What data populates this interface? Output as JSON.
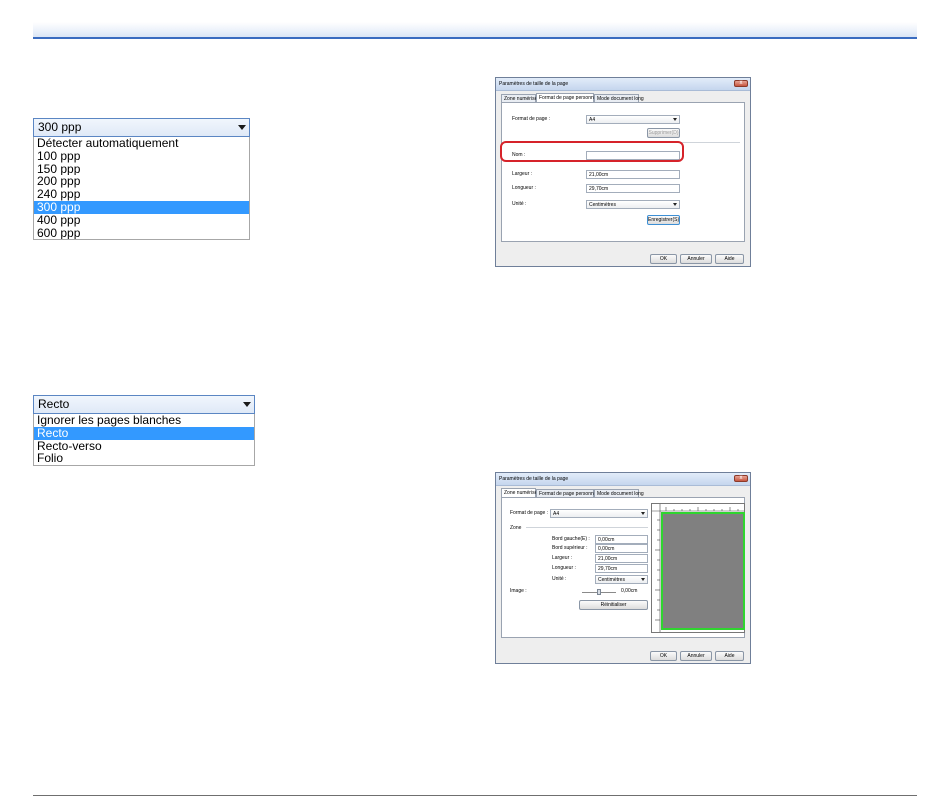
{
  "resolution_dropdown": {
    "selected": "300 ppp",
    "options": [
      "Détecter automatiquement",
      "100 ppp",
      "150 ppp",
      "200 ppp",
      "240 ppp",
      "300 ppp",
      "400 ppp",
      "600 ppp"
    ],
    "highlighted_index": 5
  },
  "side_dropdown": {
    "selected": "Recto",
    "options": [
      "Ignorer les pages blanches",
      "Recto",
      "Recto-verso",
      "Folio"
    ],
    "highlighted_index": 1
  },
  "dialog1": {
    "title": "Paramètres de taille de la page",
    "close": "x",
    "tabs": [
      "Zone numérisée",
      "Format de page personnalisé",
      "Mode document long"
    ],
    "active_tab": 1,
    "format_label": "Format de page :",
    "format_value": "A4",
    "delete_button": "Supprimer(D)",
    "name_label": "Nom :",
    "name_value": "",
    "width_label": "Largeur :",
    "width_value": "21,00cm",
    "length_label": "Longueur :",
    "length_value": "29,70cm",
    "unit_label": "Unité :",
    "unit_value": "Centimètres",
    "save_button": "Enregistrer(S)",
    "ok": "OK",
    "cancel": "Annuler",
    "help": "Aide"
  },
  "dialog2": {
    "title": "Paramètres de taille de la page",
    "close": "x",
    "tabs": [
      "Zone numérisée",
      "Format de page personnalisé",
      "Mode document long"
    ],
    "active_tab": 0,
    "format_label": "Format de page :",
    "format_value": "A4",
    "zone_label": "Zone",
    "left_label": "Bord gauche(E) :",
    "left_value": "0,00cm",
    "top_label": "Bord supérieur :",
    "top_value": "0,00cm",
    "width_label": "Largeur :",
    "width_value": "21,00cm",
    "length_label": "Longueur :",
    "length_value": "29,70cm",
    "unit_label": "Unité :",
    "unit_value": "Centimètres",
    "image_label": "Image :",
    "image_value": "0,00cm",
    "image_slider_fraction": 0.5,
    "reset_button": "Réinitialiser",
    "ok": "OK",
    "cancel": "Annuler",
    "help": "Aide",
    "preview_fill_color": "#808080",
    "preview_border_color": "#2fd52f"
  },
  "colors": {
    "selection": "#3399ff",
    "highlight_ring": "#d6232a",
    "header_rule": "#3a6cc0"
  }
}
